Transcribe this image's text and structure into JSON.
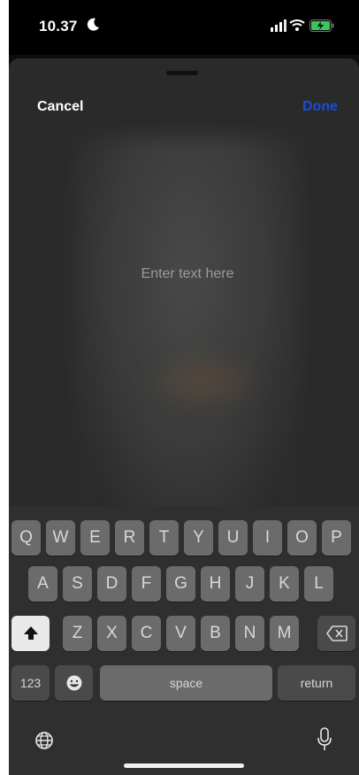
{
  "status_bar": {
    "time": "10.37"
  },
  "editor": {
    "cancel_label": "Cancel",
    "done_label": "Done",
    "text_placeholder": "Enter text here",
    "done_color": "#1a4dd8"
  },
  "keyboard": {
    "row1": [
      "Q",
      "W",
      "E",
      "R",
      "T",
      "Y",
      "U",
      "I",
      "O",
      "P"
    ],
    "row2": [
      "A",
      "S",
      "D",
      "F",
      "G",
      "H",
      "J",
      "K",
      "L"
    ],
    "row3": [
      "Z",
      "X",
      "C",
      "V",
      "B",
      "N",
      "M"
    ],
    "numbers_label": "123",
    "space_label": "space",
    "return_label": "return",
    "icons": [
      "shift-icon",
      "backspace-icon",
      "emoji-icon",
      "globe-icon",
      "microphone-icon"
    ]
  }
}
